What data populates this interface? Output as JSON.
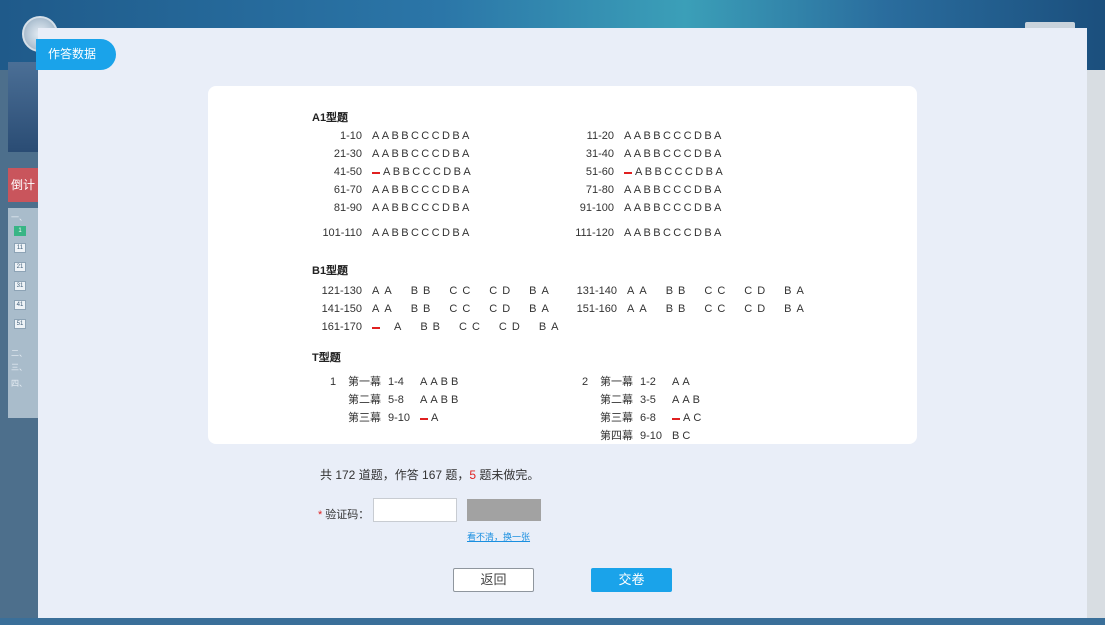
{
  "app": {
    "countdown_tag": "倒计",
    "nav_boxes": [
      "1",
      "11",
      "21",
      "31",
      "41",
      "51"
    ],
    "nav_texts": [
      "一、",
      "二、",
      "三、",
      "四、"
    ]
  },
  "modal": {
    "tag": "作答数据"
  },
  "sections": {
    "a1": {
      "title": "A1型题",
      "left": [
        {
          "range": "1-10",
          "answers": "AABBCCCDBA",
          "missing_first": false
        },
        {
          "range": "21-30",
          "answers": "AABBCCCDBA",
          "missing_first": false
        },
        {
          "range": "41-50",
          "answers": "ABBCCCDBA",
          "missing_first": true
        },
        {
          "range": "61-70",
          "answers": "AABBCCCDBA",
          "missing_first": false
        },
        {
          "range": "81-90",
          "answers": "AABBCCCDBA",
          "missing_first": false
        },
        {
          "range": "101-110",
          "answers": "AABBCCCDBA",
          "missing_first": false
        }
      ],
      "right": [
        {
          "range": "11-20",
          "answers": "AABBCCCDBA",
          "missing_first": false
        },
        {
          "range": "31-40",
          "answers": "AABBCCCDBA",
          "missing_first": false
        },
        {
          "range": "51-60",
          "answers": "ABBCCCDBA",
          "missing_first": true
        },
        {
          "range": "71-80",
          "answers": "AABBCCCDBA",
          "missing_first": false
        },
        {
          "range": "91-100",
          "answers": "AABBCCCDBA",
          "missing_first": false
        },
        {
          "range": "111-120",
          "answers": "AABBCCCDBA",
          "missing_first": false
        }
      ]
    },
    "b1": {
      "title": "B1型题",
      "left": [
        {
          "range": "121-130",
          "groups": [
            "AA",
            "BB",
            "CC",
            "CD",
            "BA"
          ],
          "missing_first": false
        },
        {
          "range": "141-150",
          "groups": [
            "AA",
            "BB",
            "CC",
            "CD",
            "BA"
          ],
          "missing_first": false
        },
        {
          "range": "161-170",
          "groups": [
            "A",
            "BB",
            "CC",
            "CD",
            "BA"
          ],
          "missing_first": true
        }
      ],
      "right": [
        {
          "range": "131-140",
          "groups": [
            "AA",
            "BB",
            "CC",
            "CD",
            "BA"
          ],
          "missing_first": false
        },
        {
          "range": "151-160",
          "groups": [
            "AA",
            "BB",
            "CC",
            "CD",
            "BA"
          ],
          "missing_first": false
        }
      ]
    },
    "t": {
      "title": "T型题",
      "case1": {
        "number": "1",
        "acts": [
          {
            "act": "第一幕",
            "range": "1-4",
            "answers": "AABB",
            "missing_first": false
          },
          {
            "act": "第二幕",
            "range": "5-8",
            "answers": "AABB",
            "missing_first": false
          },
          {
            "act": "第三幕",
            "range": "9-10",
            "answers": "A",
            "missing_first": true
          }
        ]
      },
      "case2": {
        "number": "2",
        "acts": [
          {
            "act": "第一幕",
            "range": "1-2",
            "answers": "AA",
            "missing_first": false
          },
          {
            "act": "第二幕",
            "range": "3-5",
            "answers": "AAB",
            "missing_first": false
          },
          {
            "act": "第三幕",
            "range": "6-8",
            "answers": "AC",
            "missing_first": true
          },
          {
            "act": "第四幕",
            "range": "9-10",
            "answers": "BC",
            "missing_first": false
          }
        ]
      }
    }
  },
  "summary": {
    "prefix": "共 172 道题，作答 167 题，",
    "unfinished": "5",
    "suffix": " 题未做完。"
  },
  "captcha": {
    "label": "验证码：",
    "required_mark": "*",
    "value": "",
    "placeholder": "",
    "refresh_link": "看不清，换一张"
  },
  "buttons": {
    "back": "返回",
    "submit": "交卷"
  },
  "colors": {
    "accent": "#1aa3ea",
    "missing": "#e02020"
  }
}
